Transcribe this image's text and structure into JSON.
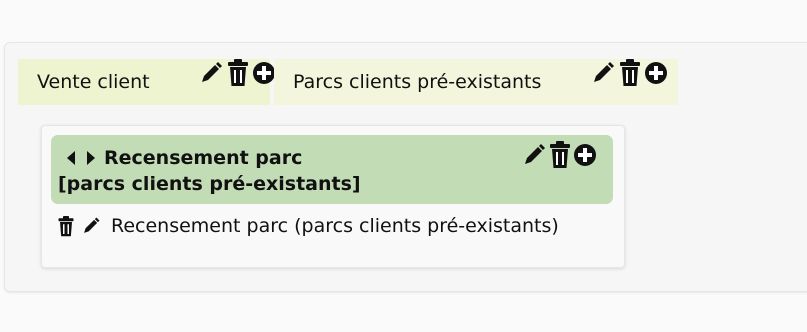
{
  "tabs": [
    {
      "label": "Vente client"
    },
    {
      "label": "Parcs clients pré-existants"
    }
  ],
  "card": {
    "title_line1": "Recensement parc",
    "title_line2": "[parcs clients pré-existants]"
  },
  "entry": {
    "label": "Recensement parc (parcs clients pré-existants)"
  },
  "icons": {
    "edit": "pencil-icon",
    "delete": "trash-icon",
    "add": "plus-circle-icon",
    "prev": "caret-left-icon",
    "next": "caret-right-icon"
  },
  "colors": {
    "tab_bg": "#eef3d0",
    "card_header_bg": "#c2dcb6"
  }
}
